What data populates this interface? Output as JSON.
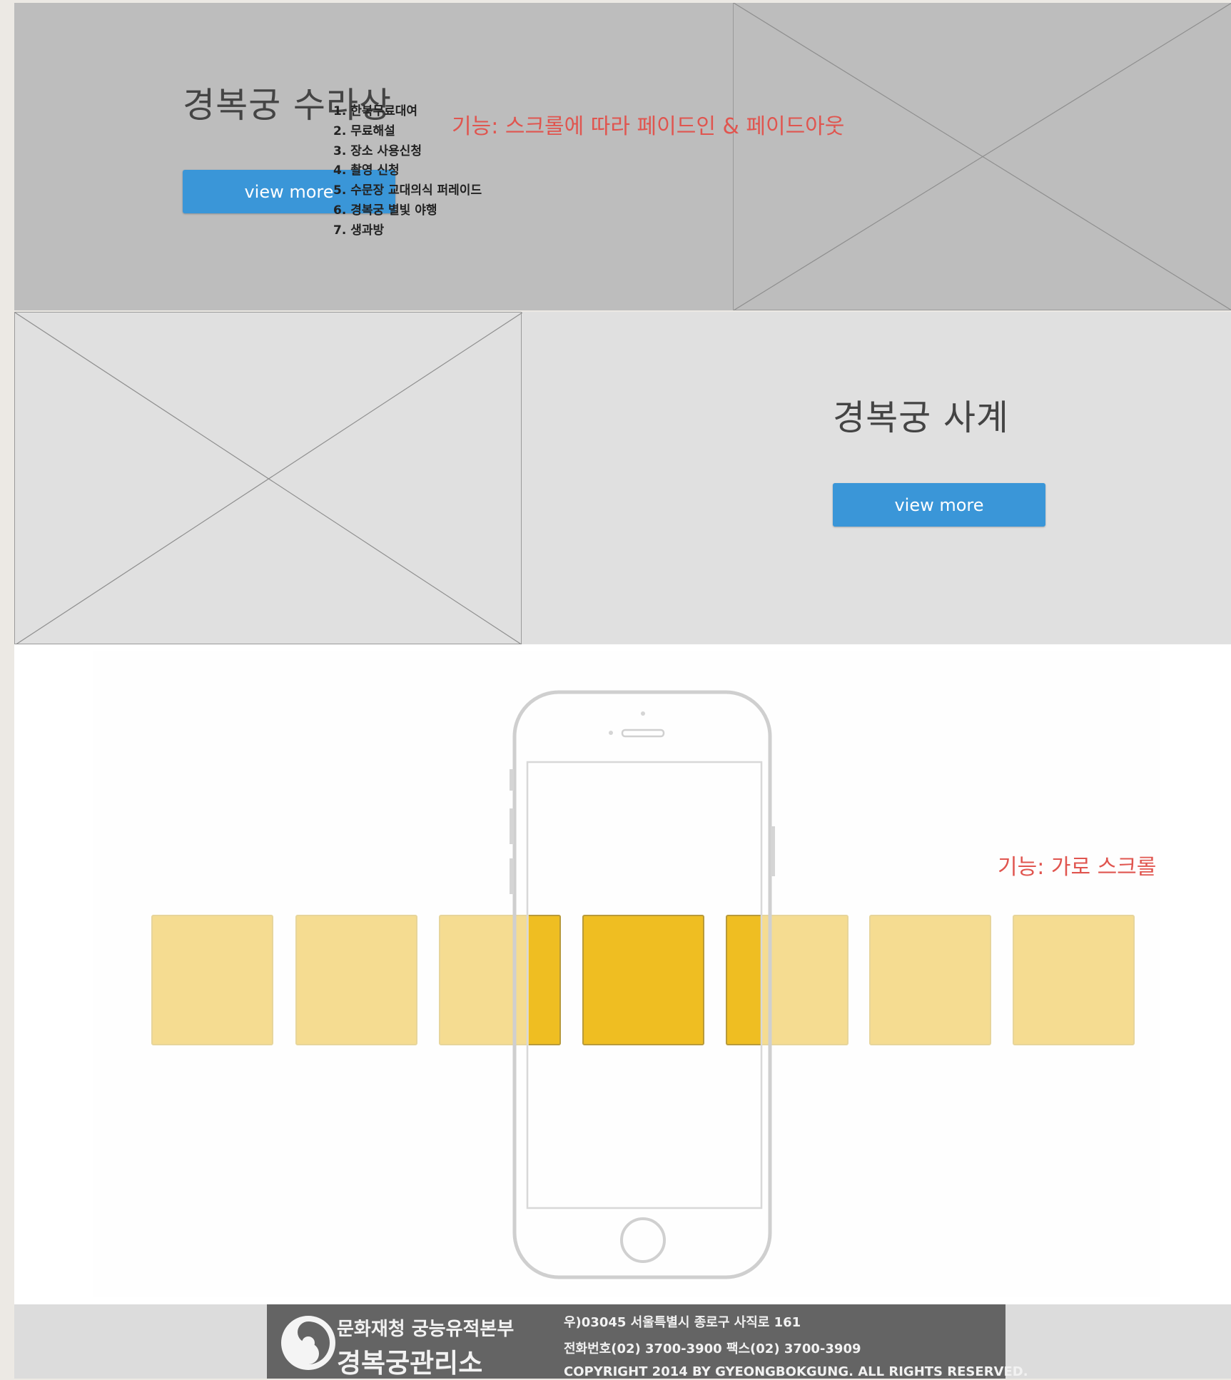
{
  "sections": {
    "surasang": {
      "title": "경복궁 수라상",
      "button_label": "view more",
      "feature_note": "기능: 스크롤에 따라 페이드인 & 페이드아웃"
    },
    "sagye": {
      "title": "경복궁 사계",
      "button_label": "view more"
    },
    "programs": {
      "items": [
        "1. 한복무료대여",
        "2. 무료해설",
        "3. 장소 사용신청",
        "4. 촬영 신청",
        "5. 수문장 교대의식 퍼레이드",
        "6. 경복궁 별빛 야행",
        "7. 생과방"
      ],
      "feature_note": "기능: 가로 스크롤",
      "card_colors": {
        "inactive": "#f5dc91",
        "active": "#efbe22"
      }
    }
  },
  "footer": {
    "org_line1": "문화재청 궁능유적본부",
    "org_line2": "경복궁관리소",
    "address": "우)03045 서울특별시 종로구 사직로 161",
    "phone": "전화번호(02) 3700-3900 팩스(02) 3700-3909",
    "copyright": "COPYRIGHT 2014 BY GYEONGBOKGUNG. ALL RIGHTS RESERVED."
  },
  "colors": {
    "button": "#3a96d8",
    "note": "#e0554f",
    "section1_bg": "#bdbdbd",
    "section2_bg": "#e0e0e0",
    "footer_bar": "#646464"
  }
}
